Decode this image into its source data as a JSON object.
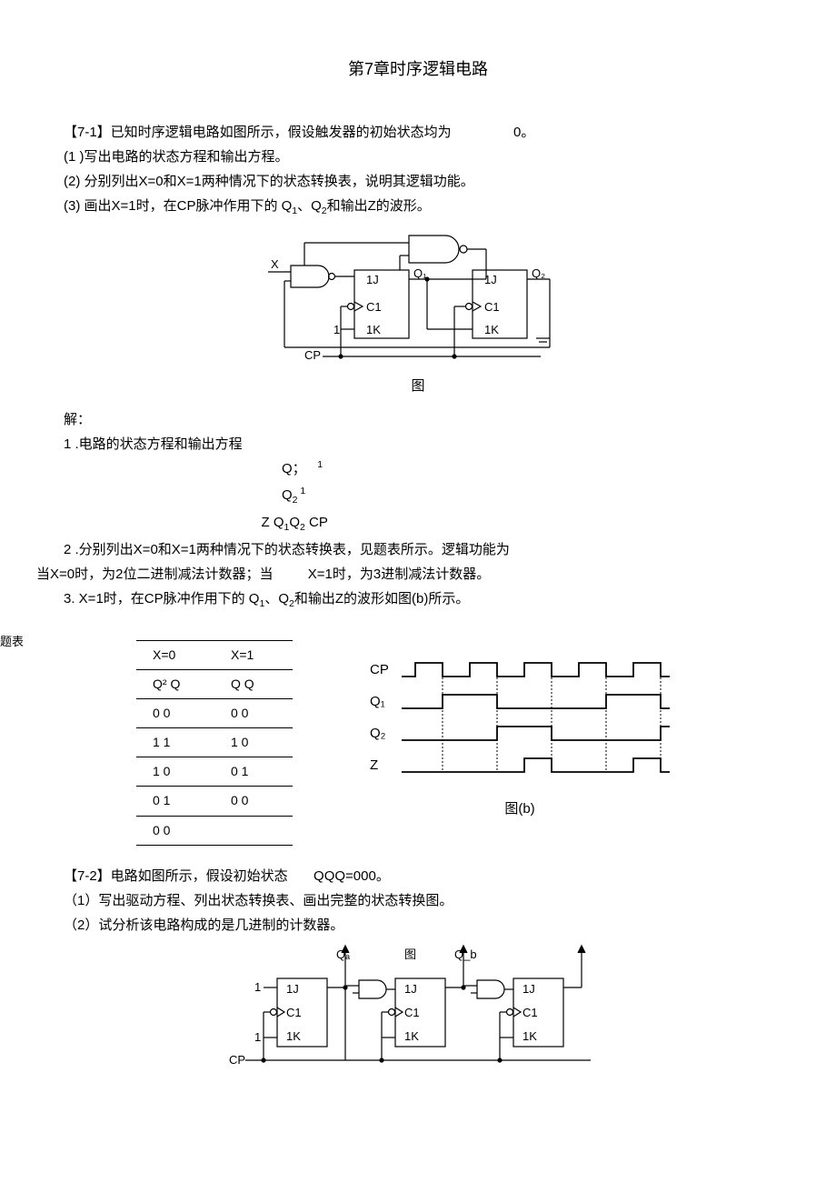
{
  "title": "第7章时序逻辑电路",
  "p71_intro": "【7-1】已知时序逻辑电路如图所示，假设触发器的初始状态均为",
  "p71_intro_tail": "0。",
  "p71_q1": "(1 )写出电路的状态方程和输出方程。",
  "p71_q2": "(2)   分别列出X=0和X=1两种情况下的状态转换表，说明其逻辑功能。",
  "p71_q3_a": "(3)   画出X=1时，在CP脉冲作用下的 Q",
  "p71_q3_b": "、Q",
  "p71_q3_c": "和输出Z的波形。",
  "fig_label_1": "图",
  "fig1": {
    "X": "X",
    "Q1": "Q₁",
    "Q2": "Q₂",
    "J1": "1J",
    "C1": "C1",
    "K1": "1K",
    "One": "1",
    "CP": "CP"
  },
  "sol_header": "解：",
  "sol_1": "1 .电路的状态方程和输出方程",
  "eq1_a": "Q；",
  "eq1_b": "1",
  "eq2_a": "Q",
  "eq2_b": "2",
  "eq2_c": " 1",
  "eq3": "Z Q",
  "eq3_b": "1",
  "eq3_c": "Q",
  "eq3_d": "2",
  "eq3_e": "CP",
  "sol_2_a": "2  .分别列出X=0和X=1两种情况下的状态转换表，见题表所示。逻辑功能为",
  "sol_2_b": "当X=0时，为2位二进制减法计数器；当",
  "sol_2_c": "X=1时，为3进制减法计数器。",
  "sol_3_a": "3.  X=1时，在CP脉冲作用下的 Q",
  "sol_3_b": "、Q",
  "sol_3_c": "和输出Z的波形如图(b)所示。",
  "side_label": "题表",
  "table": {
    "h1": "X=0",
    "h2": "X=1",
    "h3": "Q² Q",
    "h4": "Q Q",
    "rows": [
      [
        "0 0",
        "0 0"
      ],
      [
        "1 1",
        "1 0"
      ],
      [
        "1 0",
        "0 1"
      ],
      [
        "0 1",
        "0 0"
      ],
      [
        "0 0",
        ""
      ]
    ]
  },
  "timing": {
    "CP": "CP",
    "Q1": "Q₁",
    "Q2": "Q₂",
    "Z": "Z"
  },
  "fig_b": "图(b)",
  "p72_intro": "【7-2】电路如图所示，假设初始状态",
  "p72_intro_tail": "QQQ=000。",
  "p72_q1": "（1）写出驱动方程、列出状态转换表、画出完整的状态转换图。",
  "p72_q2": "（2）试分析该电路构成的是几进制的计数器。",
  "fig2_label": "图",
  "fig2": {
    "Qa": "Qₐ",
    "Qb": "Q_b",
    "One": "1",
    "J": "1J",
    "C": "C1",
    "K": "1K",
    "CP": "CP"
  }
}
